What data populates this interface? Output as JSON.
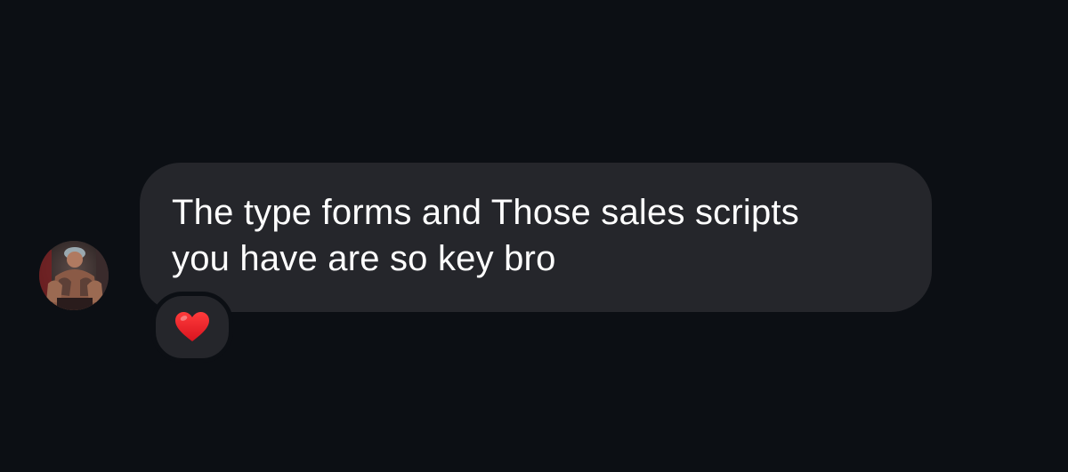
{
  "conversation": {
    "message": {
      "lines": [
        "The type forms and Those sales scripts",
        "you have are so key bro"
      ],
      "reaction": "heart-emoji"
    },
    "avatar": {
      "icon": "profile-photo"
    }
  },
  "colors": {
    "background": "#0c0f14",
    "bubble": "#25262b",
    "text": "#ffffff",
    "heart": "#e8202a"
  }
}
